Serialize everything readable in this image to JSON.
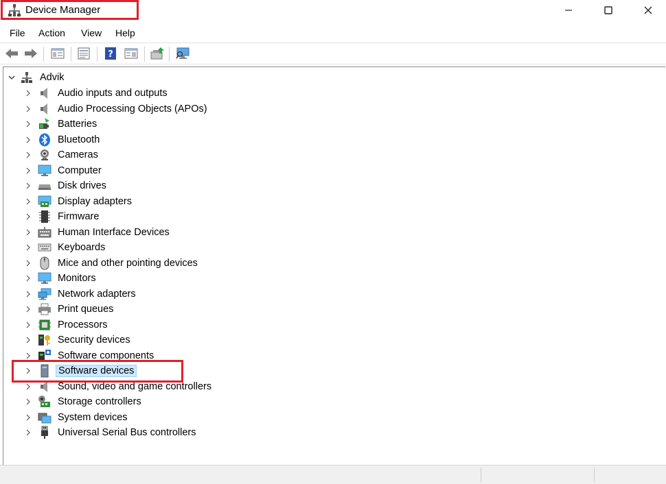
{
  "window": {
    "title": "Device Manager"
  },
  "menu": [
    {
      "label": "File"
    },
    {
      "label": "Action"
    },
    {
      "label": "View"
    },
    {
      "label": "Help"
    }
  ],
  "toolbar": [
    {
      "icon": "back-arrow-icon"
    },
    {
      "icon": "forward-arrow-icon"
    },
    {
      "icon": "show-hide-console-tree-icon"
    },
    {
      "icon": "properties-icon"
    },
    {
      "icon": "help-icon"
    },
    {
      "icon": "action-pane-icon"
    },
    {
      "icon": "update-driver-icon"
    },
    {
      "icon": "scan-hardware-changes-icon"
    }
  ],
  "tree": {
    "root": "Advik",
    "categories": [
      {
        "label": "Audio inputs and outputs",
        "icon": "speaker-icon"
      },
      {
        "label": "Audio Processing Objects (APOs)",
        "icon": "speaker-icon"
      },
      {
        "label": "Batteries",
        "icon": "battery-icon"
      },
      {
        "label": "Bluetooth",
        "icon": "bluetooth-icon"
      },
      {
        "label": "Cameras",
        "icon": "camera-icon"
      },
      {
        "label": "Computer",
        "icon": "monitor-icon"
      },
      {
        "label": "Disk drives",
        "icon": "disk-drive-icon"
      },
      {
        "label": "Display adapters",
        "icon": "display-adapter-icon"
      },
      {
        "label": "Firmware",
        "icon": "firmware-chip-icon"
      },
      {
        "label": "Human Interface Devices",
        "icon": "hid-icon"
      },
      {
        "label": "Keyboards",
        "icon": "keyboard-icon"
      },
      {
        "label": "Mice and other pointing devices",
        "icon": "mouse-icon"
      },
      {
        "label": "Monitors",
        "icon": "monitor-icon"
      },
      {
        "label": "Network adapters",
        "icon": "network-icon"
      },
      {
        "label": "Print queues",
        "icon": "printer-icon"
      },
      {
        "label": "Processors",
        "icon": "processor-icon"
      },
      {
        "label": "Security devices",
        "icon": "security-key-icon"
      },
      {
        "label": "Software components",
        "icon": "software-component-icon"
      },
      {
        "label": "Software devices",
        "icon": "software-device-icon",
        "selected": true
      },
      {
        "label": "Sound, video and game controllers",
        "icon": "speaker-icon"
      },
      {
        "label": "Storage controllers",
        "icon": "storage-controller-icon"
      },
      {
        "label": "System devices",
        "icon": "system-folder-icon"
      },
      {
        "label": "Universal Serial Bus controllers",
        "icon": "usb-plug-icon"
      }
    ]
  },
  "colors": {
    "highlight": "#e0202a",
    "selection": "#cce8ff",
    "accent": "#1e73d8"
  }
}
